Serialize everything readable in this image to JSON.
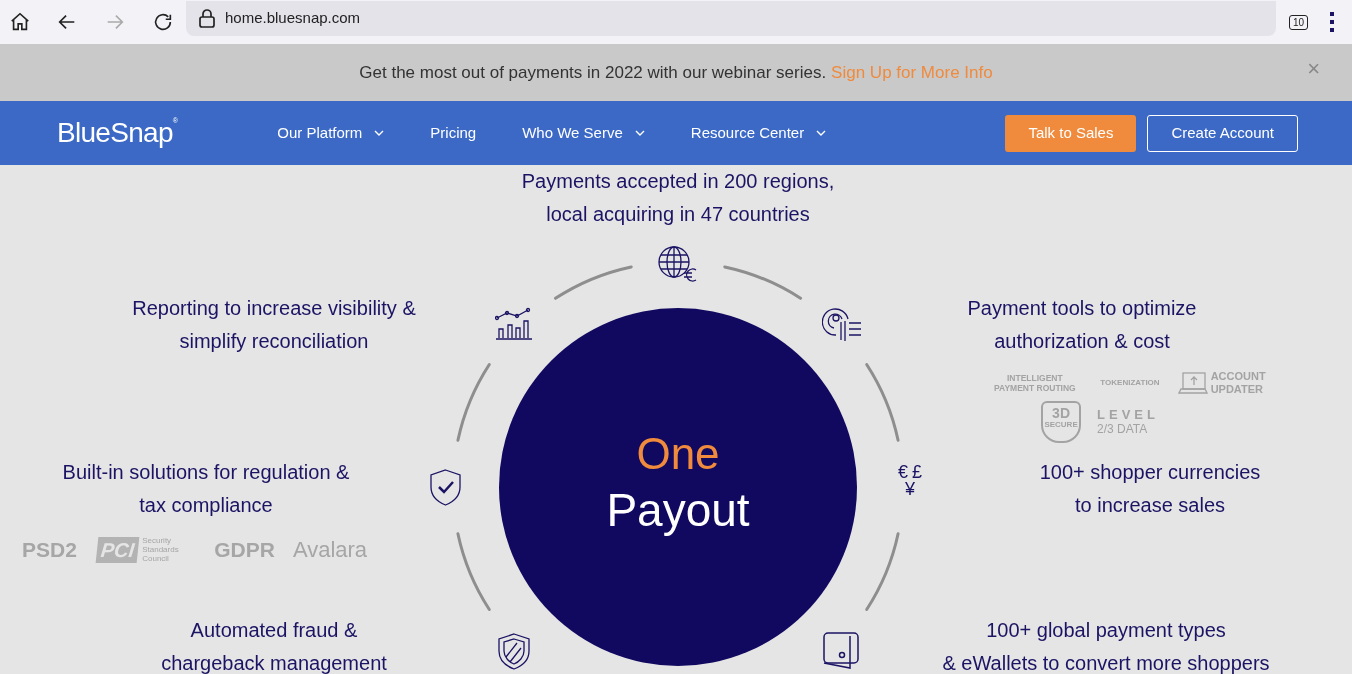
{
  "browser": {
    "url": "home.bluesnap.com",
    "tab_count": "10"
  },
  "banner": {
    "text": "Get the most out of payments in 2022 with our webinar series.",
    "link": "Sign Up for More Info",
    "close": "×"
  },
  "nav": {
    "logo": "BlueSnap",
    "logo_mark": "®",
    "items": [
      {
        "label": "Our Platform",
        "dropdown": true
      },
      {
        "label": "Pricing",
        "dropdown": false
      },
      {
        "label": "Who We Serve",
        "dropdown": true
      },
      {
        "label": "Resource Center",
        "dropdown": true
      }
    ],
    "buttons": [
      {
        "label": "Talk to Sales",
        "kind": "primary"
      },
      {
        "label": "Create Account",
        "kind": "outline"
      }
    ]
  },
  "hub": {
    "title": "One",
    "subtitle": "Payout"
  },
  "features": [
    {
      "lines": [
        "Payments accepted in 200 regions,",
        "local acquiring in 47 countries"
      ]
    },
    {
      "lines": [
        "Reporting to increase visibility &",
        "simplify reconciliation"
      ]
    },
    {
      "lines": [
        "Payment tools to optimize",
        "authorization & cost"
      ]
    },
    {
      "lines": [
        "Built-in solutions for regulation &",
        "tax compliance"
      ]
    },
    {
      "lines": [
        "100+ shopper currencies",
        "to increase sales"
      ]
    },
    {
      "lines": [
        "Automated fraud &",
        "chargeback management"
      ]
    },
    {
      "lines": [
        "100+ global payment types",
        "& eWallets to convert more shoppers"
      ]
    }
  ],
  "currency_symbols": [
    "€",
    "£",
    "¥"
  ],
  "payment_tool_logos": {
    "routing": "INTELLIGENT PAYMENT ROUTING",
    "tokenization": "TOKENIZATION",
    "updater": "ACCOUNT UPDATER",
    "secure_big": "3D",
    "secure_small": "SECURE",
    "level": "LEVEL",
    "level_data": "2/3 DATA"
  },
  "compliance_logos": {
    "psd2": "PSD2",
    "pci": "PCI",
    "pci_council": "Security Standards Council",
    "gdpr": "GDPR",
    "avalara": "Avalara"
  }
}
